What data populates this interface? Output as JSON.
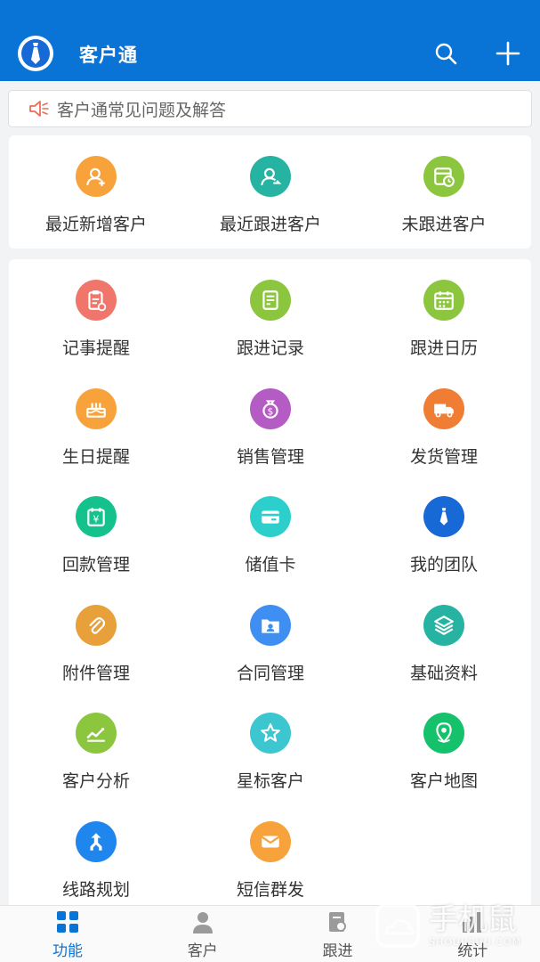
{
  "header": {
    "title": "客户通",
    "search_icon": "search-icon",
    "add_icon": "plus-icon"
  },
  "notice": {
    "icon": "speaker-icon",
    "text": "客户通常见问题及解答"
  },
  "quick_actions": [
    {
      "label": "最近新增客户",
      "icon": "user-add-icon",
      "color": "#f7a23b"
    },
    {
      "label": "最近跟进客户",
      "icon": "user-follow-icon",
      "color": "#26b3a1"
    },
    {
      "label": "未跟进客户",
      "icon": "calendar-clock-icon",
      "color": "#8cc63f"
    }
  ],
  "functions": [
    {
      "label": "记事提醒",
      "icon": "clipboard-icon",
      "color": "#f0766b"
    },
    {
      "label": "跟进记录",
      "icon": "notebook-icon",
      "color": "#8cc63f"
    },
    {
      "label": "跟进日历",
      "icon": "calendar-icon",
      "color": "#8cc63f"
    },
    {
      "label": "生日提醒",
      "icon": "cake-icon",
      "color": "#f7a23b"
    },
    {
      "label": "销售管理",
      "icon": "money-bag-icon",
      "color": "#b45bc4"
    },
    {
      "label": "发货管理",
      "icon": "truck-icon",
      "color": "#ef7d34"
    },
    {
      "label": "回款管理",
      "icon": "yen-calendar-icon",
      "color": "#15c28d"
    },
    {
      "label": "储值卡",
      "icon": "card-icon",
      "color": "#2ccfcc"
    },
    {
      "label": "我的团队",
      "icon": "tie-icon",
      "color": "#1769d6"
    },
    {
      "label": "附件管理",
      "icon": "paperclip-icon",
      "color": "#e8a03a"
    },
    {
      "label": "合同管理",
      "icon": "contract-folder-icon",
      "color": "#3f8ff2"
    },
    {
      "label": "基础资料",
      "icon": "layers-icon",
      "color": "#26b3a1"
    },
    {
      "label": "客户分析",
      "icon": "line-chart-icon",
      "color": "#8cc63f"
    },
    {
      "label": "星标客户",
      "icon": "star-icon",
      "color": "#3cc6d0"
    },
    {
      "label": "客户地图",
      "icon": "map-pin-icon",
      "color": "#15c26b"
    },
    {
      "label": "线路规划",
      "icon": "route-icon",
      "color": "#1f86ee"
    },
    {
      "label": "短信群发",
      "icon": "mail-icon",
      "color": "#f7a23b"
    }
  ],
  "tabs": [
    {
      "label": "功能",
      "icon": "grid-icon",
      "active": true
    },
    {
      "label": "客户",
      "icon": "person-icon",
      "active": false
    },
    {
      "label": "跟进",
      "icon": "follow-doc-icon",
      "active": false
    },
    {
      "label": "统计",
      "icon": "stats-icon",
      "active": false
    }
  ],
  "watermark": {
    "text": "手机鼠",
    "sub": "SHOUJISHU.COM"
  },
  "colors": {
    "header_bg": "#0a74d6",
    "active_tab": "#0a74d6"
  }
}
